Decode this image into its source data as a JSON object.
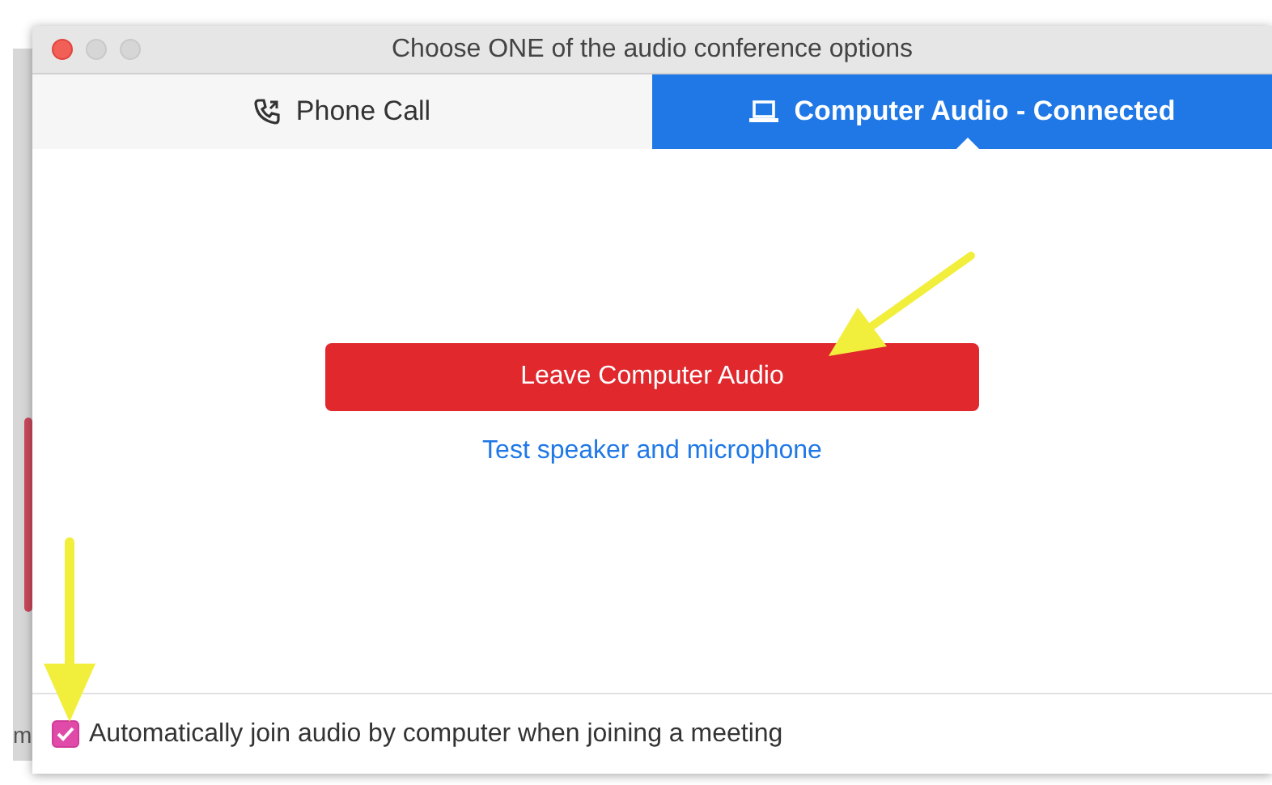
{
  "background": {
    "text": "m"
  },
  "window": {
    "title": "Choose ONE of the audio conference options"
  },
  "tabs": [
    {
      "label": "Phone Call",
      "kind": "phone",
      "selected": false
    },
    {
      "label": "Computer Audio - Connected",
      "kind": "computer",
      "selected": true
    }
  ],
  "leave_button": "Leave Computer Audio",
  "test_link": "Test speaker and microphone",
  "auto_join": {
    "label": "Automatically join audio by computer when joining a meeting",
    "checked": true
  }
}
